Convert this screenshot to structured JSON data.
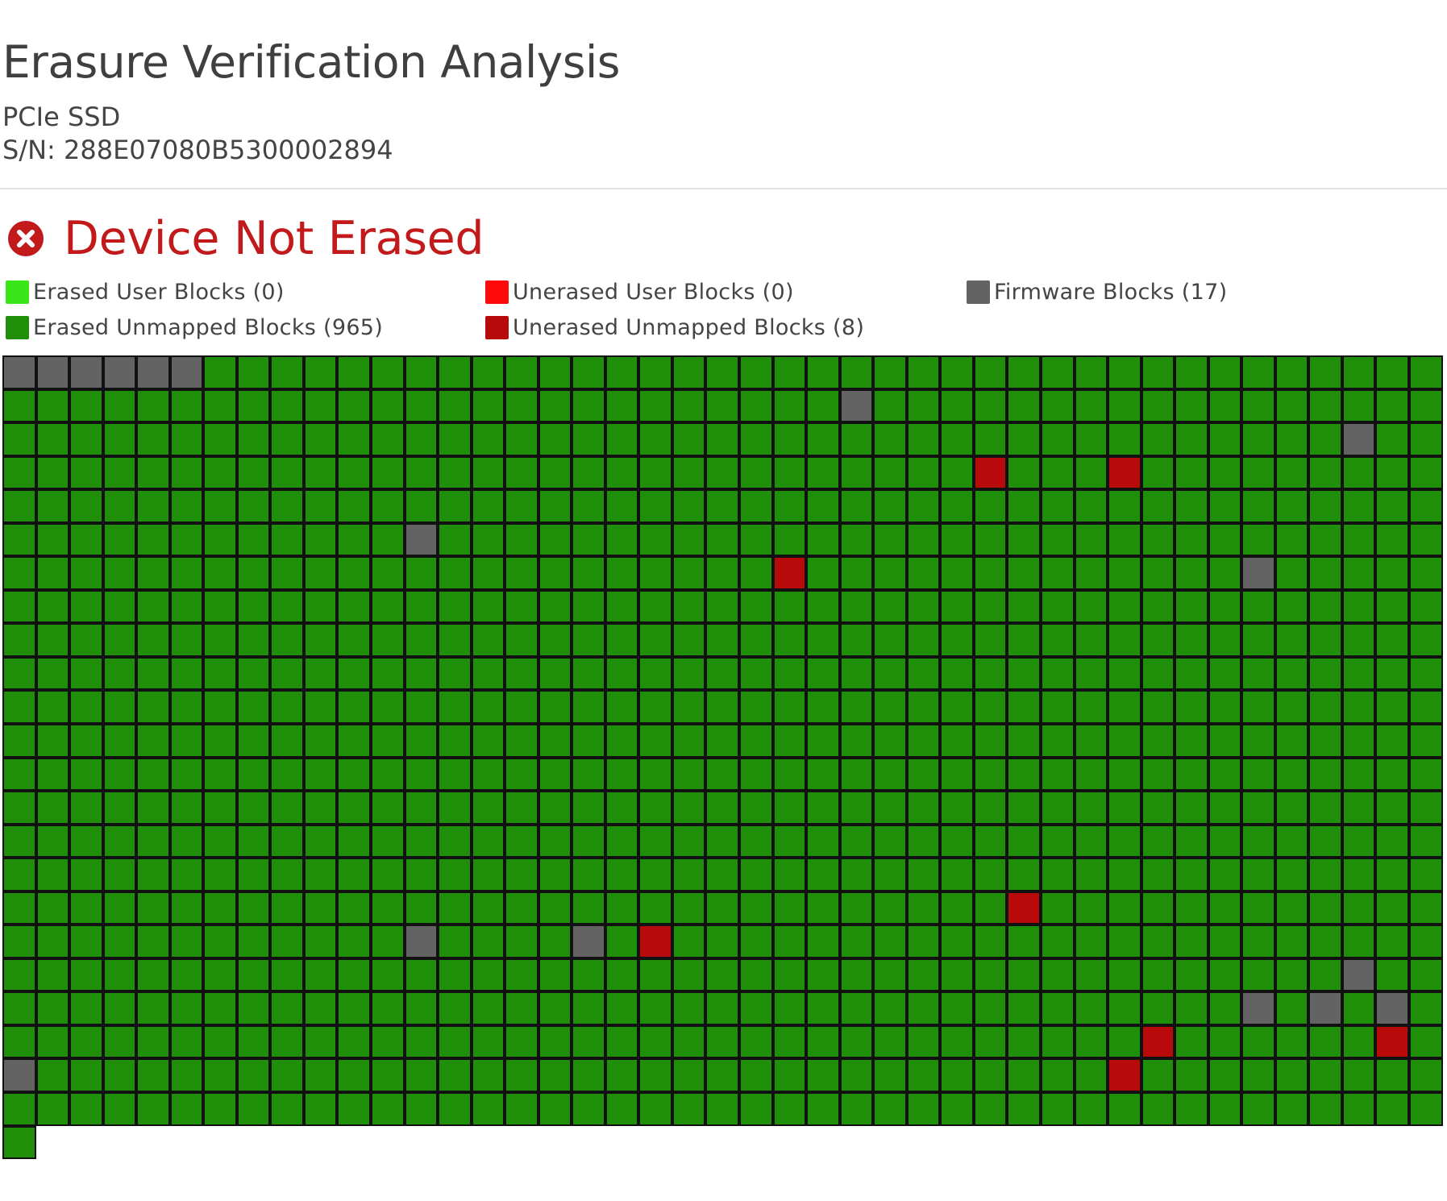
{
  "header": {
    "title": "Erasure Verification Analysis",
    "device_type": "PCIe SSD",
    "serial": "S/N: 288E07080B5300002894"
  },
  "status": {
    "text": "Device Not Erased",
    "icon": "error-x-circle-icon",
    "color": "#c2191b"
  },
  "legend": [
    {
      "label": "Erased User Blocks (0)",
      "type": "erased_user",
      "color": "#39e617"
    },
    {
      "label": "Unerased User Blocks (0)",
      "type": "unerased_user",
      "color": "#ff0a0a"
    },
    {
      "label": "Firmware Blocks (17)",
      "type": "firmware",
      "color": "#636363"
    },
    {
      "label": "Erased Unmapped Blocks (965)",
      "type": "erased_unmapped",
      "color": "#1f8f0a"
    },
    {
      "label": "Unerased Unmapped Blocks (8)",
      "type": "unerased_unmapped",
      "color": "#b80a0a"
    }
  ],
  "block_map": {
    "columns": 43,
    "total_blocks": 990,
    "default_type": "erased_unmapped",
    "firmware_blocks": [
      0,
      1,
      2,
      3,
      4,
      5,
      68,
      126,
      227,
      295,
      743,
      748,
      814,
      854,
      856,
      858,
      903
    ],
    "unerased_unmapped_blocks": [
      158,
      162,
      281,
      750,
      718,
      894,
      901,
      936
    ]
  }
}
